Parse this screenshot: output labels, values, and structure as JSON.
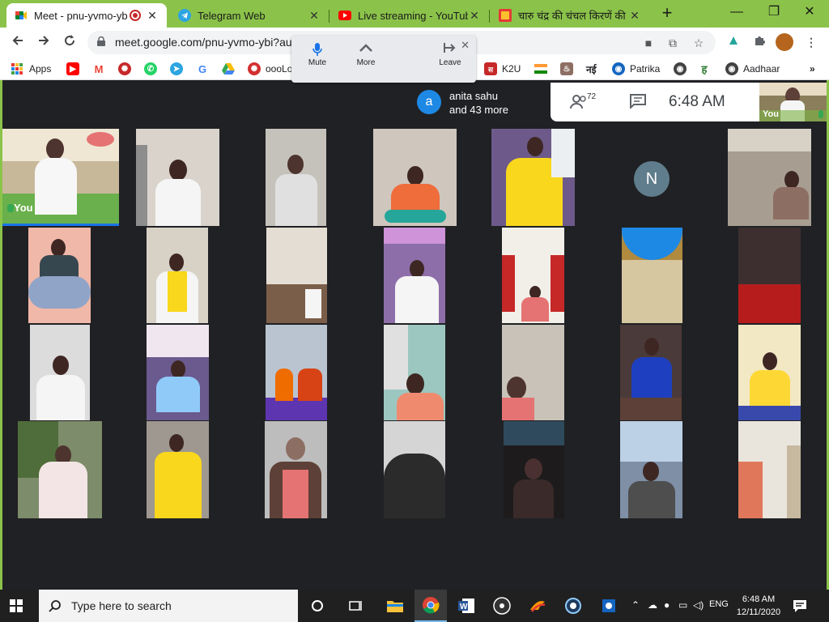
{
  "tabs": [
    {
      "title": "Meet - pnu-yvmo-yb",
      "active": true
    },
    {
      "title": "Telegram Web",
      "active": false
    },
    {
      "title": "Live streaming - YouTube",
      "active": false
    },
    {
      "title": "चारु चंद्र की चंचल किरणें की",
      "active": false
    }
  ],
  "window_controls": {
    "minimize": "—",
    "restore": "❐",
    "close": "✕"
  },
  "address_bar": {
    "url": "meet.google.com/pnu-yvmo-ybi?au"
  },
  "bookmarks": [
    {
      "label": "Apps"
    },
    {
      "label": ""
    },
    {
      "label": ""
    },
    {
      "label": ""
    },
    {
      "label": ""
    },
    {
      "label": ""
    },
    {
      "label": ""
    },
    {
      "label": ""
    },
    {
      "label": "oooLo"
    },
    {
      "label": "K2U"
    },
    {
      "label": ""
    },
    {
      "label": ""
    },
    {
      "label": "नई"
    },
    {
      "label": "Patrika"
    },
    {
      "label": ""
    },
    {
      "label": ""
    },
    {
      "label": "Aadhaar"
    }
  ],
  "floating_controls": {
    "mute": "Mute",
    "more": "More",
    "leave": "Leave"
  },
  "join_toast": {
    "avatar_letter": "a",
    "line1": "anita sahu",
    "line2": "and 43 more"
  },
  "meeting": {
    "participant_count": "72",
    "time": "6:48  AM",
    "self_label": "You",
    "tile_self_label": "You",
    "avatar_letter": "N"
  },
  "taskbar": {
    "search_placeholder": "Type here to search",
    "language": "ENG",
    "clock_time": "6:48 AM",
    "clock_date": "12/11/2020"
  },
  "colors": {
    "chrome_frame": "#8bc34a",
    "meet_bg": "#202124",
    "taskbar_bg": "#202020",
    "accent_blue": "#1a73e8"
  }
}
